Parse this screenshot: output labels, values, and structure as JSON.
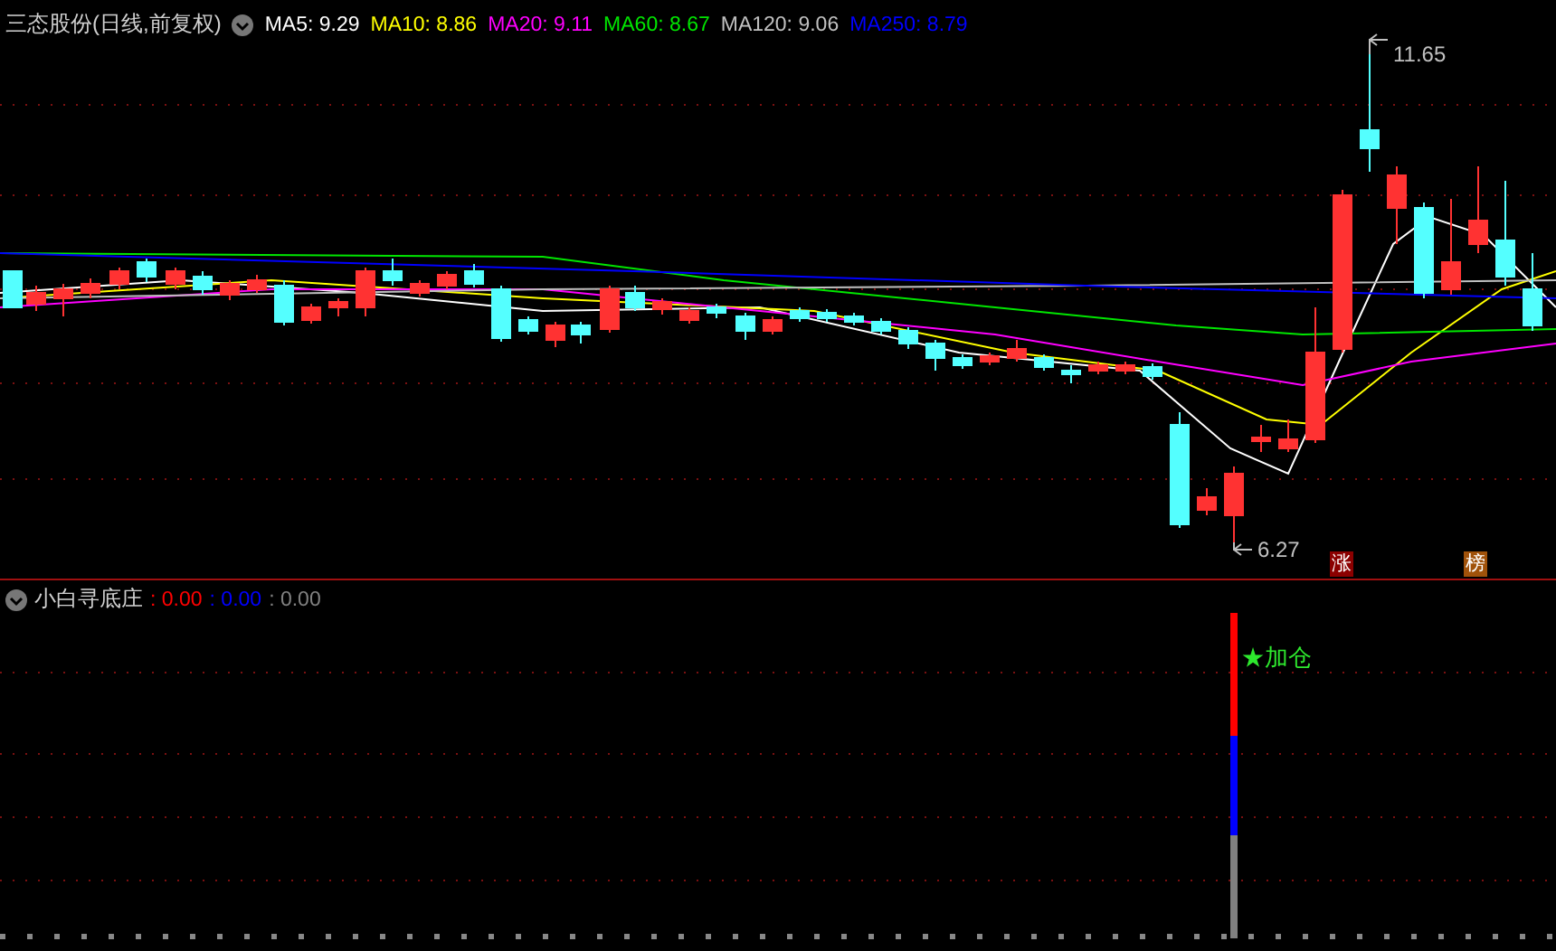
{
  "main_chart": {
    "title": "三态股份(日线,前复权)",
    "moving_averages": [
      {
        "label": "MA5: 9.29",
        "color": "#ffffff"
      },
      {
        "label": "MA10: 8.86",
        "color": "#ffff00"
      },
      {
        "label": "MA20: 9.11",
        "color": "#ff00ff"
      },
      {
        "label": "MA60: 8.67",
        "color": "#00e600"
      },
      {
        "label": "MA120: 9.06",
        "color": "#c0c0c0"
      },
      {
        "label": "MA250: 8.79",
        "color": "#0000ff"
      }
    ],
    "high_label": "11.65",
    "low_label": "6.27",
    "badges": [
      {
        "text": "涨",
        "color": "#8b0000"
      },
      {
        "text": "榜",
        "color": "#a0520a"
      }
    ]
  },
  "indicator": {
    "title": "小白寻底庄",
    "values": [
      {
        "text": ": 0.00",
        "color": "#ff0000"
      },
      {
        "text": ": 0.00",
        "color": "#0000ff"
      },
      {
        "text": ": 0.00",
        "color": "#808080"
      }
    ],
    "signal": "★加仓"
  }
}
